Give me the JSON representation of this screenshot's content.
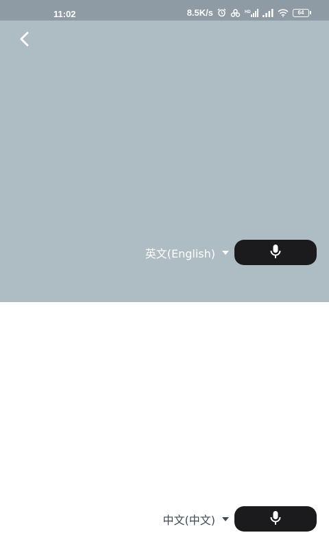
{
  "status_bar": {
    "time": "11:02",
    "net_speed": "8.5K/s",
    "battery": "64",
    "icons": [
      "alarm-icon",
      "link-icon",
      "hd-signal-icon",
      "signal-icon",
      "wifi-icon",
      "battery-icon"
    ]
  },
  "colors": {
    "status_bar_bg": "#8e9aa4",
    "top_panel_bg": "#aebcc4",
    "mic_button_bg": "#1b1a1d",
    "bottom_lang_text": "#3a4a57"
  },
  "source": {
    "language_label": "英文(English)",
    "icons": [
      "back-icon",
      "dropdown-caret-icon",
      "microphone-icon"
    ]
  },
  "target": {
    "language_label": "中文(中文)",
    "icons": [
      "dropdown-caret-icon",
      "microphone-icon"
    ]
  }
}
